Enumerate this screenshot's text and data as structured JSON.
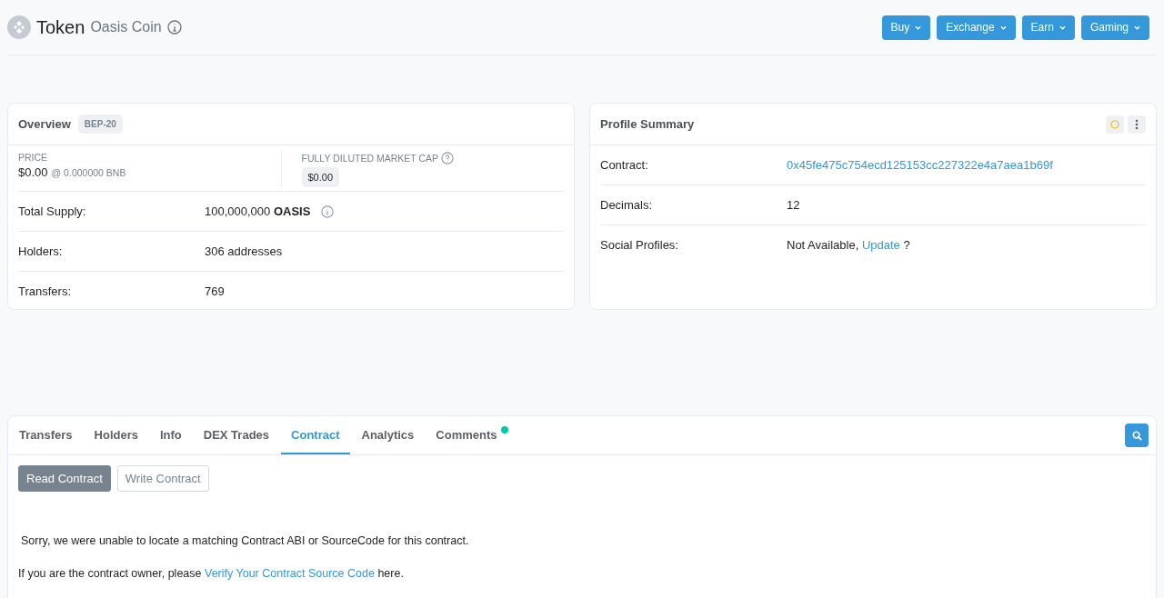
{
  "header": {
    "title": "Token",
    "subtitle": "Oasis Coin",
    "menus": [
      {
        "label": "Buy"
      },
      {
        "label": "Exchange"
      },
      {
        "label": "Earn"
      },
      {
        "label": "Gaming"
      }
    ]
  },
  "overview": {
    "title": "Overview",
    "badge": "BEP-20",
    "price_label": "PRICE",
    "price": "$0.00",
    "price_bnb": "@ 0.000000 BNB",
    "cap_label": "FULLY DILUTED MARKET CAP",
    "cap": "$0.00",
    "rows": [
      {
        "label": "Total Supply:",
        "value": "100,000,000 **OASIS**",
        "info": true
      },
      {
        "label": "Holders:",
        "value": "306 addresses",
        "info": false
      },
      {
        "label": "Transfers:",
        "value": "769",
        "info": false
      }
    ]
  },
  "profile": {
    "title": "Profile Summary",
    "contract_label": "Contract:",
    "contract": "0x45fe475c754ecd125153cc227322e4a7aea1b69f",
    "decimals_label": "Decimals:",
    "decimals": "12",
    "social_label": "Social Profiles:",
    "social_text": "Not Available,",
    "social_link": "Update",
    "social_suffix": "?"
  },
  "tabs": [
    {
      "label": "Transfers",
      "selected": false,
      "dot": false
    },
    {
      "label": "Holders",
      "selected": false,
      "dot": false
    },
    {
      "label": "Info",
      "selected": false,
      "dot": false
    },
    {
      "label": "DEX Trades",
      "selected": false,
      "dot": false
    },
    {
      "label": "Contract",
      "selected": true,
      "dot": false
    },
    {
      "label": "Analytics",
      "selected": false,
      "dot": false
    },
    {
      "label": "Comments",
      "selected": false,
      "dot": true
    }
  ],
  "subtabs": [
    {
      "label": "Read Contract",
      "selected": true
    },
    {
      "label": "Write Contract",
      "selected": false
    }
  ],
  "message": "Sorry, we were unable to locate a matching Contract ABI or SourceCode for this contract.",
  "owner_note": {
    "prefix": "If you are the contract owner, please",
    "link": "Verify Your Contract Source Code",
    "suffix": "here."
  }
}
